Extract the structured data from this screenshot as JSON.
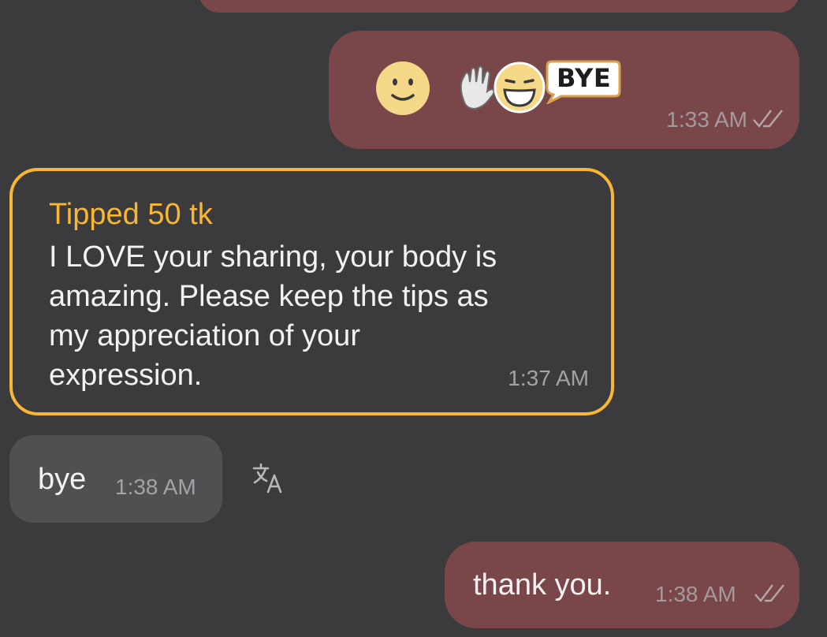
{
  "messages": {
    "emoji": {
      "sticker_bye_text": "BYE",
      "time": "1:33 AM",
      "status_icon": "double-check-icon"
    },
    "tip": {
      "title": "Tipped 50 tk",
      "body": "I LOVE your sharing, your body is\namazing. Please keep the tips as\nmy appreciation of your\nexpression.",
      "time": "1:37 AM",
      "accent_color": "#f7b733"
    },
    "bye": {
      "text": "bye",
      "time": "1:38 AM",
      "translate_icon": "translate-icon"
    },
    "thanks": {
      "text": "thank you.",
      "time": "1:38 AM",
      "status_icon": "double-check-icon"
    }
  },
  "colors": {
    "background": "#3b3b3e",
    "outgoing_bubble": "#794649",
    "incoming_bubble": "#505053"
  }
}
